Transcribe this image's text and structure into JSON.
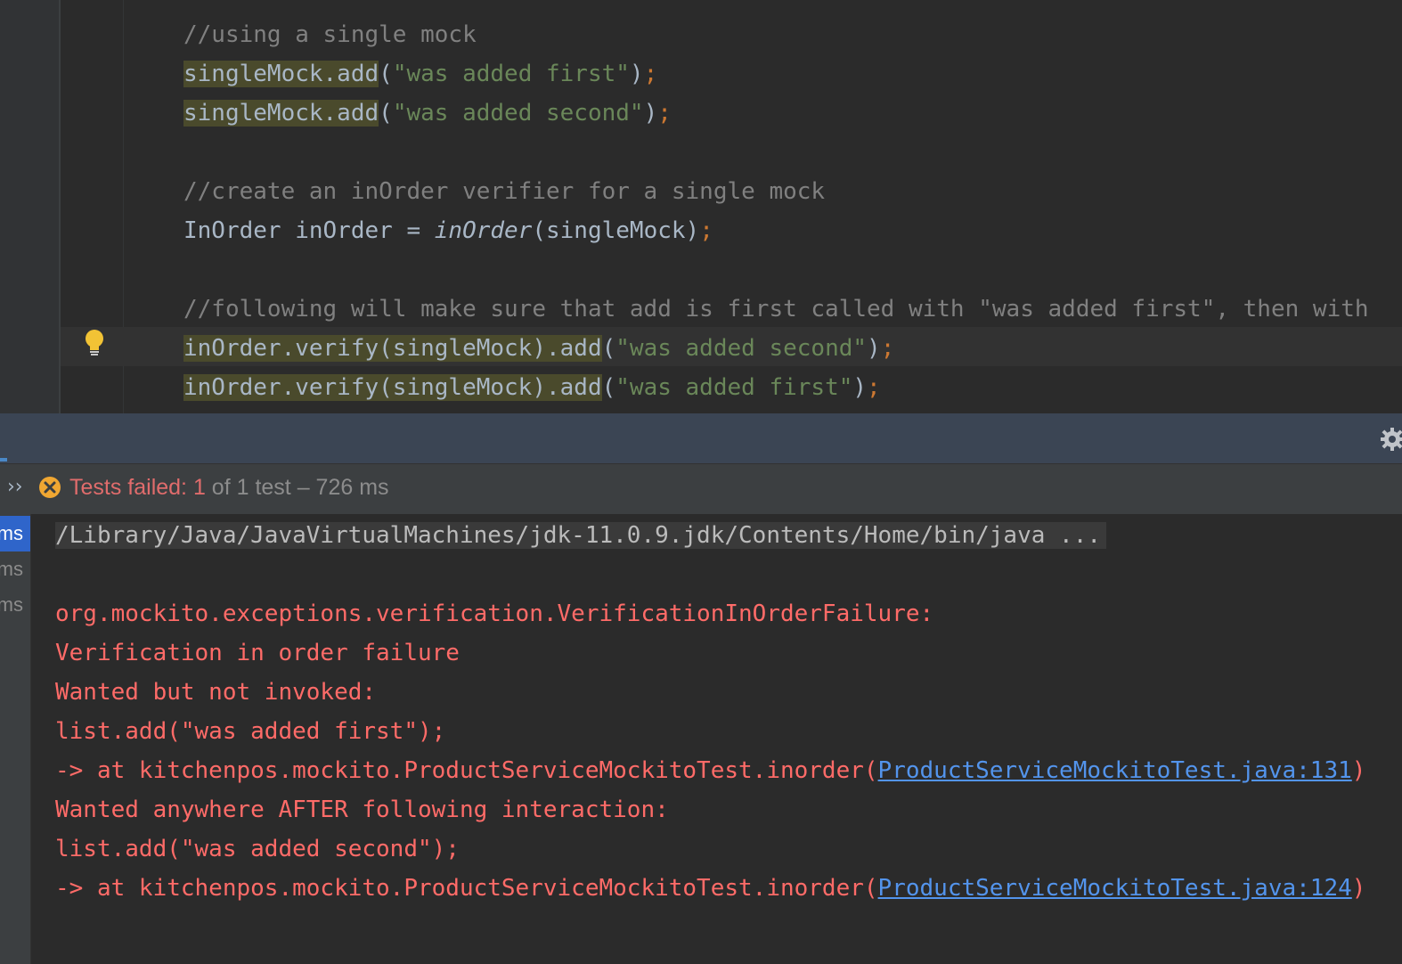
{
  "editor": {
    "lines": [
      {
        "parts": [
          {
            "t": "//using a single mock",
            "c": "comment"
          }
        ]
      },
      {
        "parts": [
          {
            "t": "singleMock.add",
            "c": "hl"
          },
          {
            "t": "(",
            "c": ""
          },
          {
            "t": "\"was added first\"",
            "c": "str"
          },
          {
            "t": ")",
            "c": ""
          },
          {
            "t": ";",
            "c": "semi"
          }
        ]
      },
      {
        "parts": [
          {
            "t": "singleMock.add",
            "c": "hl"
          },
          {
            "t": "(",
            "c": ""
          },
          {
            "t": "\"was added second\"",
            "c": "str"
          },
          {
            "t": ")",
            "c": ""
          },
          {
            "t": ";",
            "c": "semi"
          }
        ]
      },
      {
        "parts": []
      },
      {
        "parts": [
          {
            "t": "//create an inOrder verifier for a single mock",
            "c": "comment"
          }
        ]
      },
      {
        "parts": [
          {
            "t": "InOrder inOrder = ",
            "c": ""
          },
          {
            "t": "inOrder",
            "c": "ital"
          },
          {
            "t": "(singleMock)",
            "c": ""
          },
          {
            "t": ";",
            "c": "semi"
          }
        ]
      },
      {
        "parts": []
      },
      {
        "parts": [
          {
            "t": "//following will make sure that add is first called with \"was added first\", then with",
            "c": "comment"
          }
        ]
      },
      {
        "parts": [
          {
            "t": "inOrder.verify(singleMock).add",
            "c": "hl"
          },
          {
            "t": "(",
            "c": ""
          },
          {
            "t": "\"was added second\"",
            "c": "str"
          },
          {
            "t": ")",
            "c": ""
          },
          {
            "t": ";",
            "c": "semi"
          }
        ]
      },
      {
        "parts": [
          {
            "t": "inOrder.verify(singleMock).add",
            "c": "hl"
          },
          {
            "t": "(",
            "c": ""
          },
          {
            "t": "\"was added first\"",
            "c": "str"
          },
          {
            "t": ")",
            "c": ""
          },
          {
            "t": ";",
            "c": "semi"
          }
        ]
      }
    ],
    "intention_icon": "lightbulb-icon"
  },
  "run_panel": {
    "status": {
      "prefix": "Tests failed: ",
      "failed_count": "1",
      "suffix": " of 1 test – 726 ms"
    },
    "tree_items": [
      "ms",
      "ms",
      "ms"
    ],
    "icons": [
      "expand-chevron-icon",
      "test-failed-icon",
      "gear-icon"
    ]
  },
  "console": {
    "command": "/Library/Java/JavaVirtualMachines/jdk-11.0.9.jdk/Contents/Home/bin/java ...",
    "lines": [
      {
        "text": "org.mockito.exceptions.verification.VerificationInOrderFailure:"
      },
      {
        "text": "Verification in order failure"
      },
      {
        "text": "Wanted but not invoked:"
      },
      {
        "text": "list.add(\"was added first\");"
      },
      {
        "text": "-> at kitchenpos.mockito.ProductServiceMockitoTest.inorder(",
        "link": "ProductServiceMockitoTest.java:131",
        "after": ")"
      },
      {
        "text": "Wanted anywhere AFTER following interaction:"
      },
      {
        "text": "list.add(\"was added second\");"
      },
      {
        "text": "-> at kitchenpos.mockito.ProductServiceMockitoTest.inorder(",
        "link": "ProductServiceMockitoTest.java:124",
        "after": ")"
      }
    ]
  }
}
